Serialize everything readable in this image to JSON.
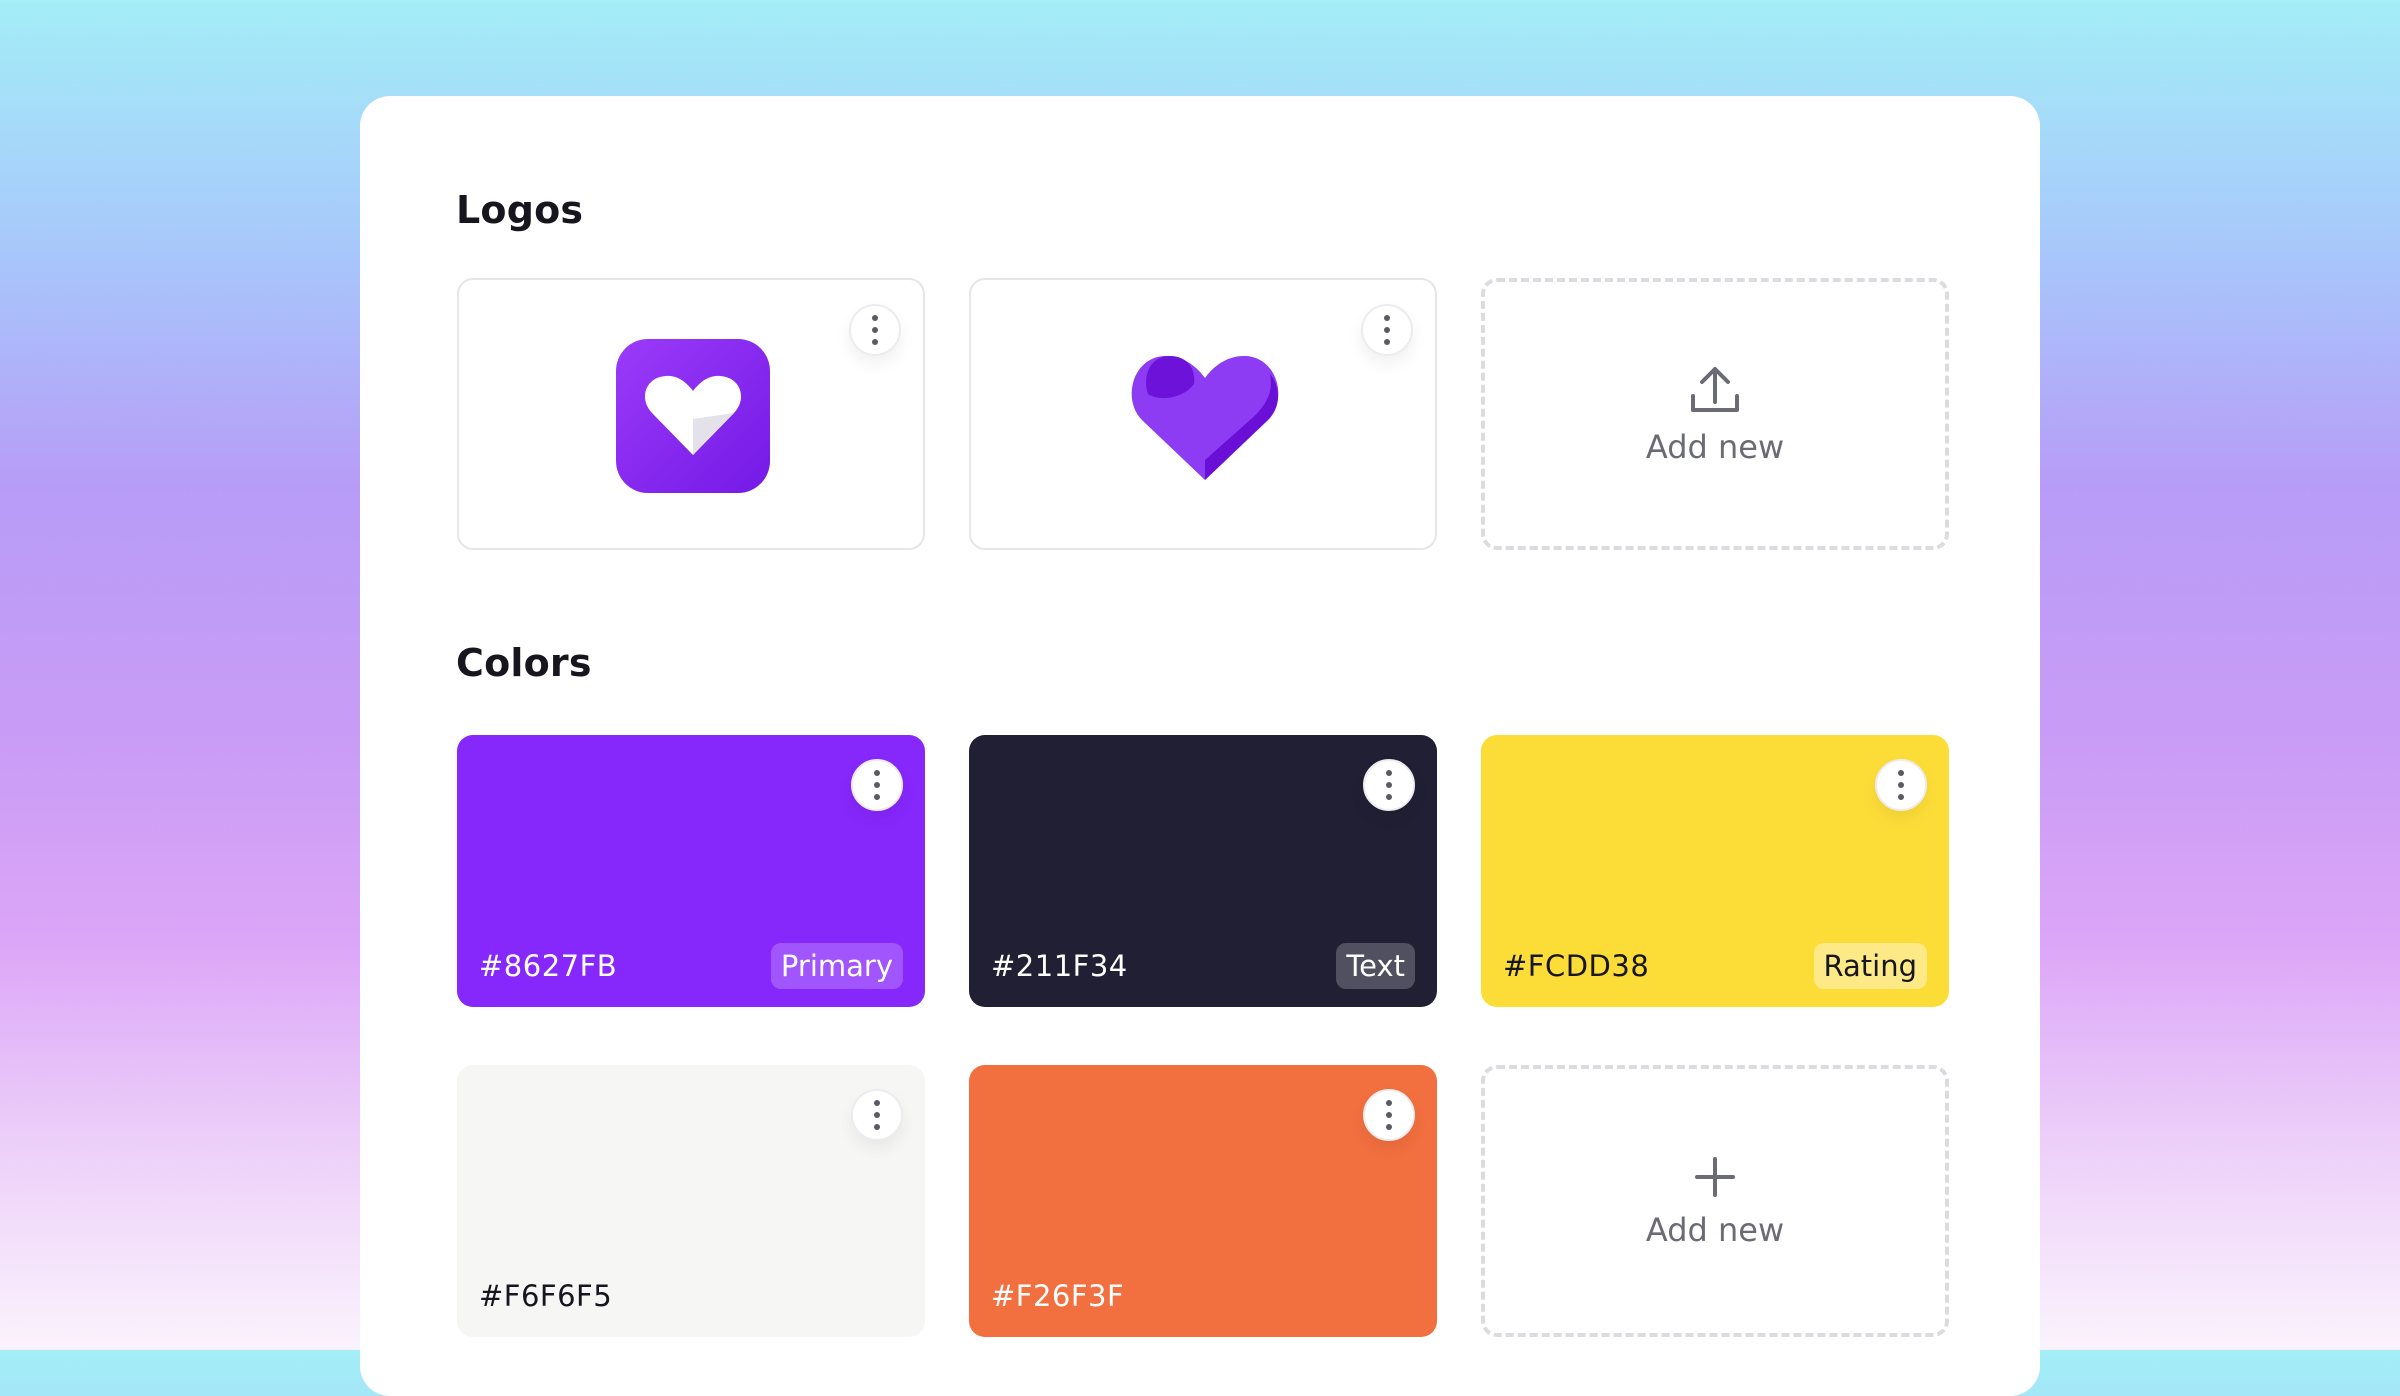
{
  "sections": {
    "logos_title": "Logos",
    "colors_title": "Colors"
  },
  "logos": {
    "items": [
      {
        "icon": "heart-app-icon"
      },
      {
        "icon": "heart-icon"
      }
    ],
    "add_new_label": "Add new",
    "add_new_icon": "upload-icon"
  },
  "colors": {
    "swatches": [
      {
        "hex": "#8627FB",
        "tag": "Primary",
        "color": "#8627FB"
      },
      {
        "hex": "#211F34",
        "tag": "Text",
        "color": "#211F34"
      },
      {
        "hex": "#FCDD38",
        "tag": "Rating",
        "color": "#FCDD38"
      },
      {
        "hex": "#F6F6F5",
        "color": "#F6F6F5"
      },
      {
        "hex": "#F26F3F",
        "color": "#F26F3F"
      }
    ],
    "add_new_label": "Add new",
    "add_new_icon": "plus-icon"
  },
  "menu_icon": "more-vertical-icon"
}
